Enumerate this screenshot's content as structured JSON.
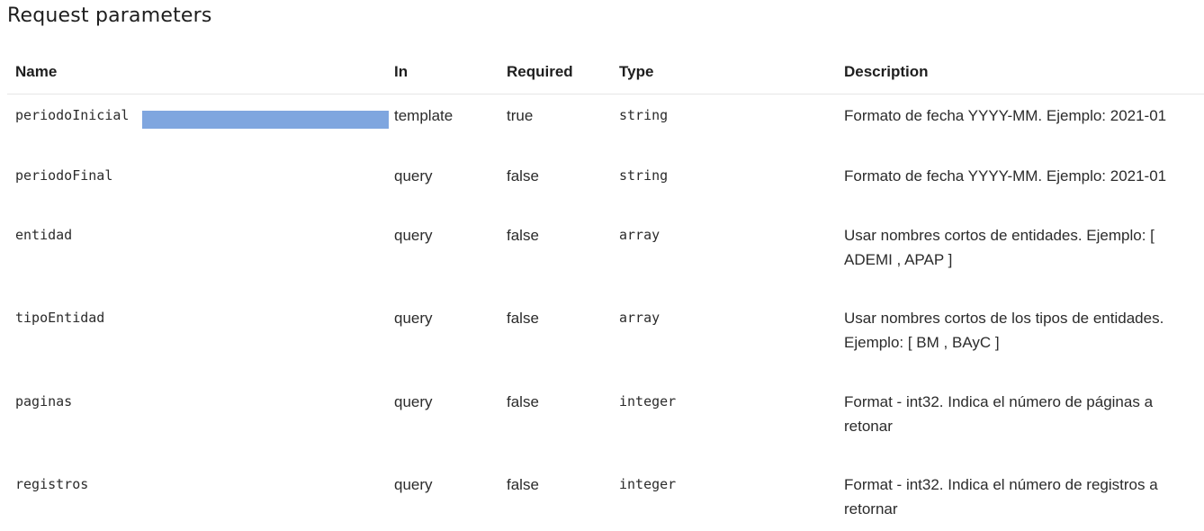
{
  "title": "Request parameters",
  "colors": {
    "redaction": "#7fa6df",
    "divider": "#e6e6e6"
  },
  "headers": {
    "name": "Name",
    "in": "In",
    "required": "Required",
    "type": "Type",
    "description": "Description"
  },
  "rows": [
    {
      "name": "periodoInicial",
      "in": "template",
      "required": "true",
      "type": "string",
      "description": "Formato de fecha YYYY-MM. Ejemplo: 2021-01",
      "redacted": true
    },
    {
      "name": "periodoFinal",
      "in": "query",
      "required": "false",
      "type": "string",
      "description": "Formato de fecha YYYY-MM. Ejemplo: 2021-01"
    },
    {
      "name": "entidad",
      "in": "query",
      "required": "false",
      "type": "array",
      "description": "Usar nombres cortos de entidades. Ejemplo: [ ADEMI , APAP ]"
    },
    {
      "name": "tipoEntidad",
      "in": "query",
      "required": "false",
      "type": "array",
      "description": "Usar nombres cortos de los tipos de entidades. Ejemplo: [ BM , BAyC ]"
    },
    {
      "name": "paginas",
      "in": "query",
      "required": "false",
      "type": "integer",
      "description": "Format - int32. Indica el número de páginas a retonar"
    },
    {
      "name": "registros",
      "in": "query",
      "required": "false",
      "type": "integer",
      "description": "Format - int32. Indica el número de registros a retornar"
    }
  ]
}
